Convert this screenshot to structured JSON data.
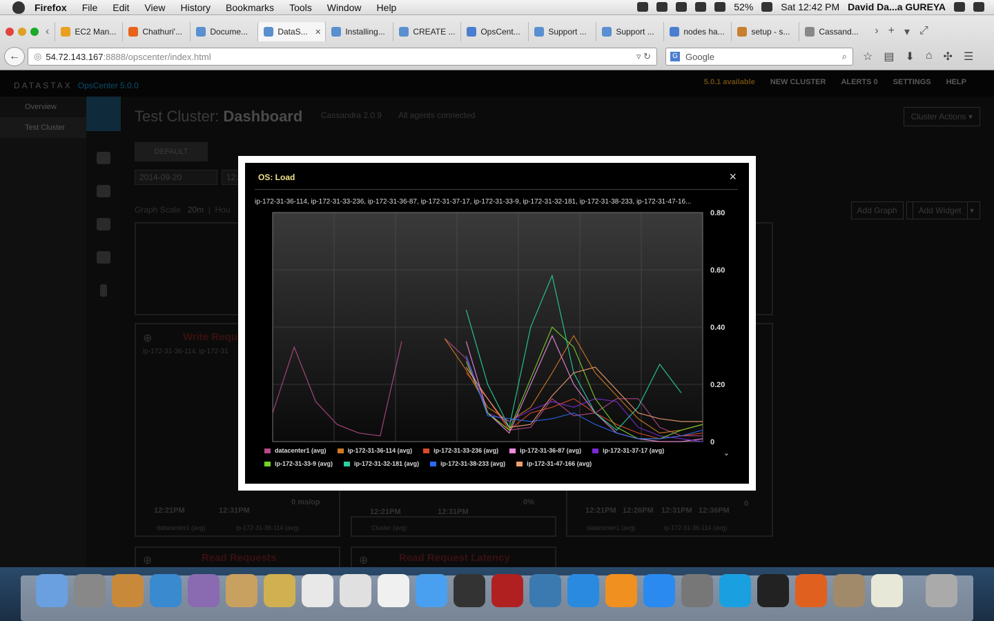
{
  "mac": {
    "menu": [
      "Firefox",
      "File",
      "Edit",
      "View",
      "History",
      "Bookmarks",
      "Tools",
      "Window",
      "Help"
    ],
    "battery": "52%",
    "clock": "Sat 12:42 PM",
    "user": "David Da...a GUREYA"
  },
  "browser": {
    "tabs": [
      {
        "label": "EC2 Man...",
        "color": "#e8a020"
      },
      {
        "label": "Chathuri'...",
        "color": "#e8641a"
      },
      {
        "label": "Docume...",
        "color": "#5a8fd0"
      },
      {
        "label": "DataS...",
        "color": "#5a8fd0",
        "active": true
      },
      {
        "label": "Installing...",
        "color": "#5a8fd0"
      },
      {
        "label": "CREATE ...",
        "color": "#5a8fd0"
      },
      {
        "label": "OpsCent...",
        "color": "#4a7fd0"
      },
      {
        "label": "Support ...",
        "color": "#5a8fd0"
      },
      {
        "label": "Support ...",
        "color": "#5a8fd0"
      },
      {
        "label": "nodes ha...",
        "color": "#4a7fd0"
      },
      {
        "label": "setup - s...",
        "color": "#c88030"
      },
      {
        "label": "Cassand...",
        "color": "#888888"
      }
    ],
    "url_host": "54.72.143.167",
    "url_rest": ":8888/opscenter/index.html",
    "search_placeholder": "Google"
  },
  "opscenter": {
    "logo": "DATASTAX",
    "version": "OpsCenter 5.0.0",
    "top": {
      "avail": "5.0.1 available",
      "new_cluster": "NEW CLUSTER",
      "alerts": "ALERTS",
      "alert_count": "0",
      "settings": "SETTINGS",
      "help": "HELP"
    },
    "nav": [
      "Overview",
      "Test Cluster"
    ],
    "cluster_name": "Test Cluster:",
    "page": "Dashboard",
    "cassandra": "Cassandra 2.0.9",
    "agents": "All agents connected",
    "cluster_actions": "Cluster Actions",
    "default_tab": "DEFAULT",
    "date": "2014-09-20",
    "time_partial": "12:2",
    "graph_scale_label": "Graph Scale",
    "graph_scale_value": "20m",
    "graph_scale_hour": "Hou",
    "add_graph": "Add Graph",
    "add_widget": "Add Widget",
    "bg_panels": {
      "write_title": "Write Reque",
      "write_sub": "ip-172-31-36-114, ip-172-31",
      "read_req": "Read Requests",
      "read_lat": "Read Request Latency",
      "ms_op": "0 ms/op",
      "pct": "0%",
      "zero": "0",
      "t1": "12:21PM",
      "t2": "12:31PM",
      "t3": "12:26PM",
      "t4": "12:36PM",
      "leg_dc": "datacenter1 (avg)",
      "leg_114": "ip-172-31-36-114 (avg)",
      "leg_cluster": "Cluster (avg)"
    }
  },
  "modal": {
    "title": "OS: Load",
    "close": "×",
    "subtitle": "ip-172-31-36-114, ip-172-31-33-236, ip-172-31-36-87, ip-172-31-37-17, ip-172-31-33-9, ip-172-31-32-181, ip-172-31-38-233, ip-172-31-47-16..."
  },
  "chart_data": {
    "type": "line",
    "title": "OS: Load",
    "ylim": [
      0,
      0.8
    ],
    "yticks": [
      "0.80",
      "0.60",
      "0.40",
      "0.20",
      "0"
    ],
    "grid": true,
    "legend_placement": "bottom",
    "x": [
      0,
      1,
      2,
      3,
      4,
      5,
      6,
      7,
      8,
      9,
      10,
      11,
      12,
      13,
      14,
      15,
      16,
      17,
      18,
      19,
      20
    ],
    "series": [
      {
        "name": "datacenter1 (avg)",
        "color": "#b54a8a",
        "values": [
          0.1,
          0.33,
          0.14,
          0.06,
          0.03,
          0.02,
          0.35,
          null,
          0.36,
          0.29,
          0.1,
          0.04,
          0.05,
          0.15,
          0.09,
          0.1,
          0.15,
          0.15,
          0.05,
          0.02,
          0.02
        ]
      },
      {
        "name": "ip-172-31-36-114 (avg)",
        "color": "#d07a20",
        "values": [
          null,
          null,
          null,
          null,
          null,
          null,
          null,
          null,
          0.36,
          0.25,
          0.12,
          0.07,
          0.12,
          0.24,
          0.37,
          0.24,
          0.16,
          0.08,
          0.03,
          0.04,
          0.06
        ]
      },
      {
        "name": "ip-172-31-33-236 (avg)",
        "color": "#d84a2a",
        "values": [
          null,
          null,
          null,
          null,
          null,
          null,
          null,
          null,
          null,
          0.24,
          0.15,
          0.04,
          0.1,
          0.12,
          0.15,
          0.1,
          0.06,
          0.03,
          0.01,
          0.02,
          0.03
        ]
      },
      {
        "name": "ip-172-31-36-87 (avg)",
        "color": "#f08ae0",
        "values": [
          null,
          null,
          null,
          null,
          null,
          null,
          null,
          null,
          null,
          0.35,
          0.1,
          0.03,
          0.2,
          0.37,
          0.2,
          0.1,
          0.03,
          0.01,
          0.0,
          0.0,
          0.01
        ]
      },
      {
        "name": "ip-172-31-37-17 (avg)",
        "color": "#7a2ad0",
        "values": [
          null,
          null,
          null,
          null,
          null,
          null,
          null,
          null,
          null,
          0.3,
          0.1,
          0.07,
          0.11,
          0.14,
          0.12,
          0.15,
          0.14,
          0.05,
          0.02,
          0.01,
          0.0
        ]
      },
      {
        "name": "ip-172-31-33-9 (avg)",
        "color": "#7ad02a",
        "values": [
          null,
          null,
          null,
          null,
          null,
          null,
          null,
          null,
          null,
          0.28,
          0.1,
          0.04,
          0.22,
          0.4,
          0.33,
          0.15,
          0.05,
          0.01,
          0.01,
          0.04,
          0.06
        ]
      },
      {
        "name": "ip-172-31-32-181 (avg)",
        "color": "#2ad0a0",
        "values": [
          null,
          null,
          null,
          null,
          null,
          null,
          null,
          null,
          null,
          0.46,
          0.2,
          0.05,
          0.4,
          0.58,
          0.24,
          0.1,
          0.04,
          0.12,
          0.27,
          0.17,
          null
        ]
      },
      {
        "name": "ip-172-31-38-233 (avg)",
        "color": "#2a6af0",
        "values": [
          null,
          null,
          null,
          null,
          null,
          null,
          null,
          null,
          null,
          0.3,
          0.09,
          0.08,
          0.07,
          0.08,
          0.1,
          0.06,
          0.03,
          0.01,
          0.01,
          0.02,
          0.04
        ]
      },
      {
        "name": "ip-172-31-47-166 (avg)",
        "color": "#f0a070",
        "values": [
          null,
          null,
          null,
          null,
          null,
          null,
          null,
          null,
          null,
          0.26,
          0.15,
          0.05,
          0.06,
          0.16,
          0.24,
          0.26,
          0.18,
          0.1,
          0.08,
          0.07,
          0.07
        ]
      }
    ]
  }
}
